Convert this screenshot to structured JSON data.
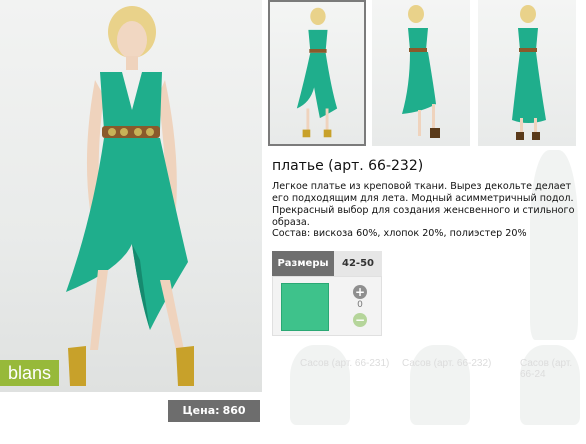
{
  "brand": {
    "label": "blans"
  },
  "product": {
    "title": "платье (арт. 66-232)",
    "description": "Легкое платье из креповой ткани. Вырез декольте делает его подходящим для лета. Модный асимметричный подол. Прекрасный выбор для создания женсвенного и стильного образа.",
    "composition": "Состав: вискоза 60%, хлопок 20%, полиэстер 20%",
    "color_hex": "#3ec28b"
  },
  "price": {
    "label": "Цена:",
    "value": "860 руб."
  },
  "sizes": {
    "header": "Размеры",
    "range": "42-50",
    "quantity": "0"
  },
  "background_captions": [
    "Сасов (арт. 66-231)",
    "Сасов (арт. 66-232)",
    "Сасов (арт. 66-24"
  ],
  "colors": {
    "dress": "#1fae8c",
    "brand_bar": "#97b93a",
    "price_bar": "#6d6d6d"
  },
  "icons": {
    "plus": "plus-circle-icon",
    "minus": "minus-circle-icon"
  }
}
